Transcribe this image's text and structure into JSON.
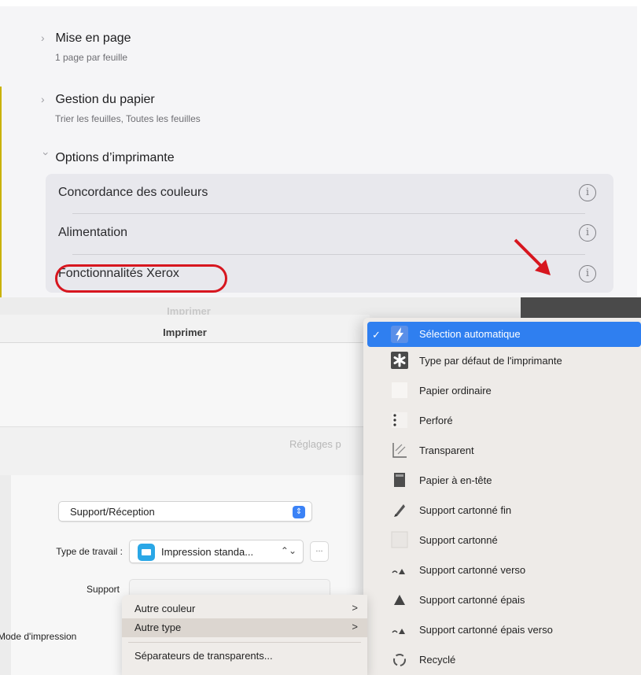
{
  "top": {
    "sections": [
      {
        "title": "Mise en page",
        "subtitle": "1 page par feuille"
      },
      {
        "title": "Gestion du papier",
        "subtitle": "Trier les feuilles, Toutes les feuilles"
      },
      {
        "title": "Options d’imprimante"
      }
    ],
    "printer_options": [
      {
        "label": "Concordance des couleurs"
      },
      {
        "label": "Alimentation"
      },
      {
        "label": "Fonctionnalités Xerox"
      }
    ],
    "info_glyph": "i",
    "annotation_color": "#d7161f"
  },
  "print_dialog": {
    "window_title_ghost": "Imprimer",
    "window_title": "Imprimer",
    "settings_ghost": "Réglages p",
    "panel_select": "Support/Réception",
    "job_type_label": "Type de travail :",
    "job_type_value": "Impression standa...",
    "more_button": "...",
    "support_label": "Support",
    "print_mode_label": "Mode d'impression",
    "stepper_glyph": "⇕",
    "popup_arrows": "⌃⌄"
  },
  "submenu": {
    "items": [
      {
        "label": "Autre couleur",
        "arrow": ">"
      },
      {
        "label": "Autre type",
        "arrow": ">",
        "highlighted": true
      },
      {
        "label": "Séparateurs de transparents..."
      }
    ]
  },
  "media_menu": {
    "accent": "#2f7ff0",
    "checkmark": "✓",
    "items": [
      {
        "label": "Sélection automatique",
        "icon": "lightning-icon",
        "selected": true
      },
      {
        "label": "Type par défaut de l'imprimante",
        "icon": "asterisk-icon"
      },
      {
        "label": "Papier ordinaire",
        "icon": "blank-paper-icon"
      },
      {
        "label": "Perforé",
        "icon": "punched-paper-icon"
      },
      {
        "label": "Transparent",
        "icon": "transparency-icon"
      },
      {
        "label": "Papier à en-tête",
        "icon": "letterhead-icon"
      },
      {
        "label": "Support cartonné fin",
        "icon": "light-cardstock-icon"
      },
      {
        "label": "Support cartonné",
        "icon": "cardstock-icon"
      },
      {
        "label": "Support cartonné verso",
        "icon": "cardstock-reverse-icon"
      },
      {
        "label": "Support cartonné épais",
        "icon": "heavy-cardstock-icon"
      },
      {
        "label": "Support cartonné épais verso",
        "icon": "heavy-cardstock-reverse-icon"
      },
      {
        "label": "Recyclé",
        "icon": "recycled-icon"
      }
    ]
  }
}
